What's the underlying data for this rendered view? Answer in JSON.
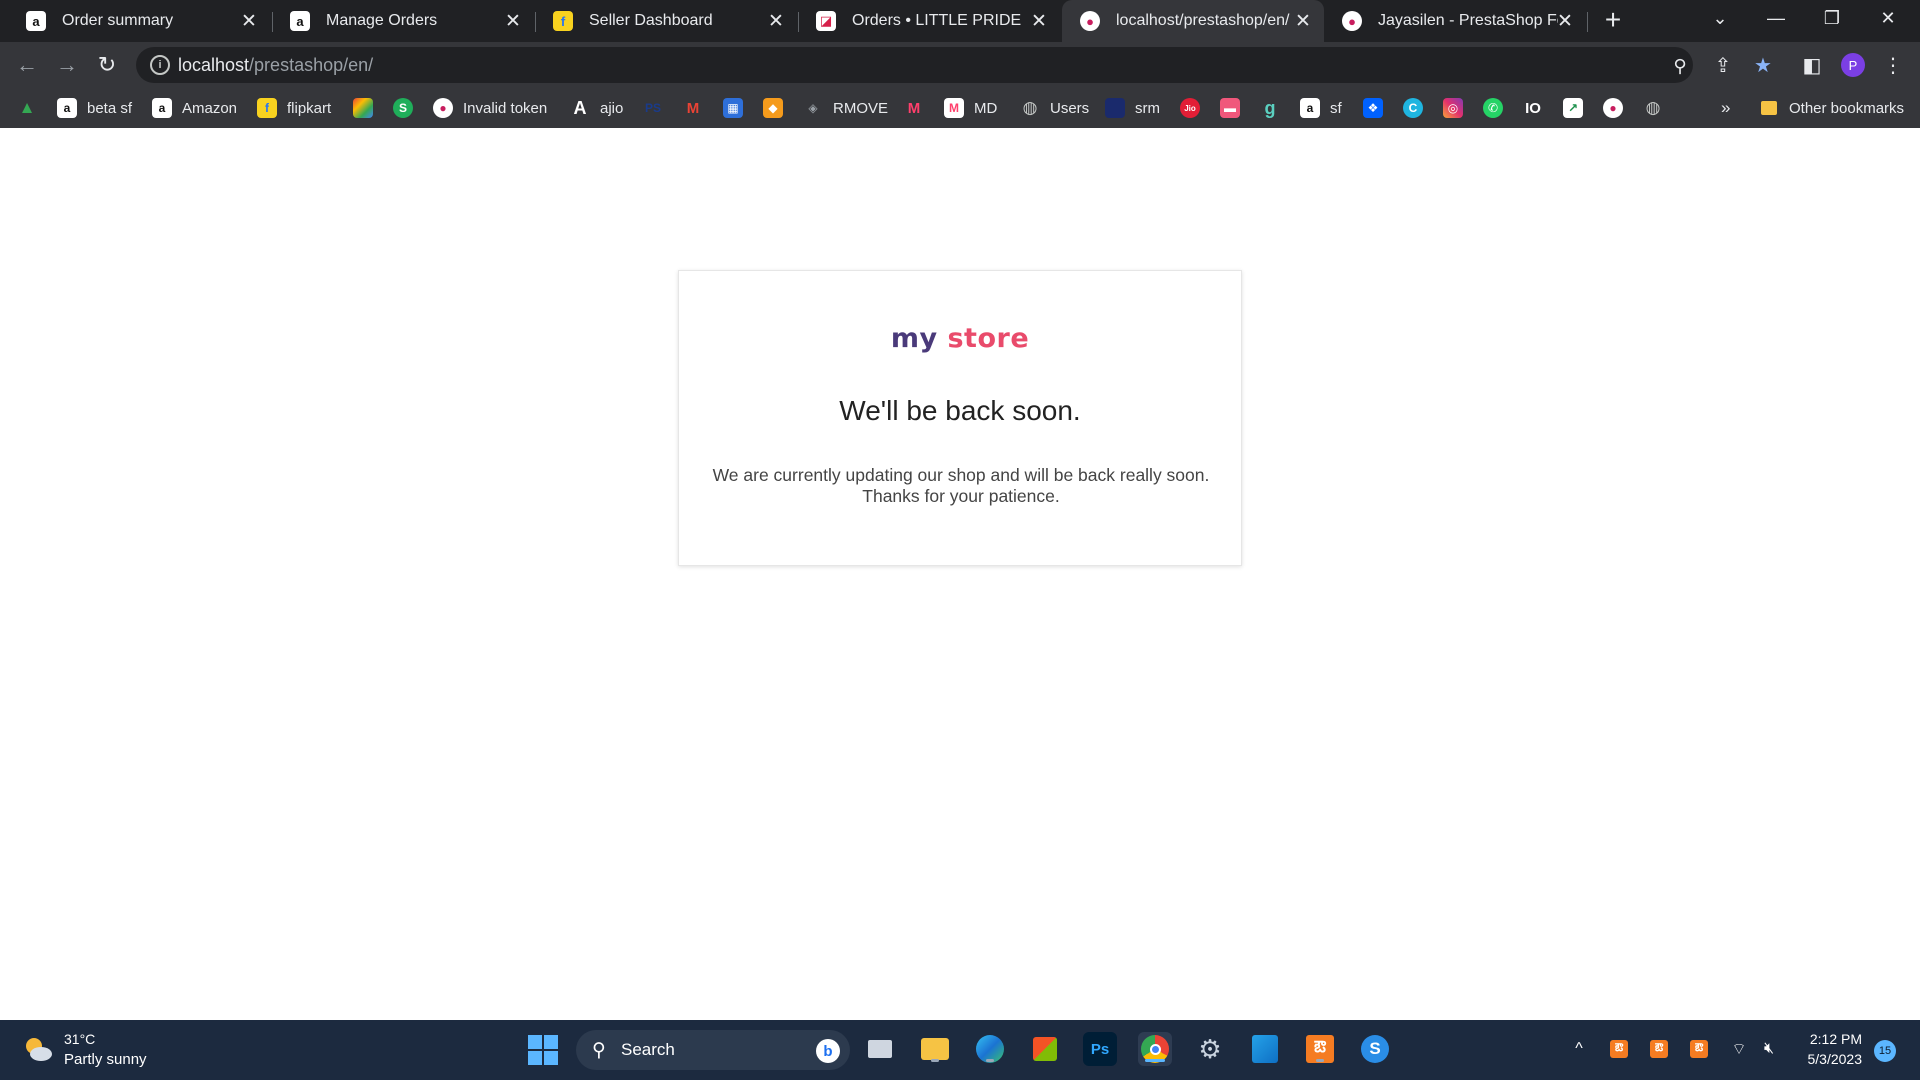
{
  "browser": {
    "tabs": [
      {
        "title": "Order summary",
        "icon": "amazon-icon",
        "active": false
      },
      {
        "title": "Manage Orders",
        "icon": "amazon-icon",
        "active": false
      },
      {
        "title": "Seller Dashboard",
        "icon": "flipkart-icon",
        "active": false
      },
      {
        "title": "Orders • LITTLE PRIDE",
        "icon": "orders-icon",
        "active": false
      },
      {
        "title": "localhost/prestashop/en/",
        "icon": "prestashop-icon",
        "active": true
      },
      {
        "title": "Jayasilen - PrestaShop Foru",
        "icon": "prestashop-icon",
        "active": false
      }
    ],
    "address": {
      "host": "localhost",
      "path": "/prestashop/en/"
    },
    "profile_initial": "P",
    "bookmarks": [
      {
        "label": "",
        "icon": "drive-icon"
      },
      {
        "label": "beta sf",
        "icon": "amazon-icon"
      },
      {
        "label": "Amazon",
        "icon": "amazon-icon"
      },
      {
        "label": "flipkart",
        "icon": "flipkart-icon"
      },
      {
        "label": "",
        "icon": "apps-grid-icon"
      },
      {
        "label": "",
        "icon": "s-icon"
      },
      {
        "label": "Invalid token",
        "icon": "prestashop-icon"
      },
      {
        "label": "ajio",
        "icon": "ajio-icon"
      },
      {
        "label": "",
        "icon": "ps-icon"
      },
      {
        "label": "",
        "icon": "gmail-icon"
      },
      {
        "label": "",
        "icon": "qr-icon"
      },
      {
        "label": "",
        "icon": "ticket-icon"
      },
      {
        "label": "RMOVE",
        "icon": "layers-icon"
      },
      {
        "label": "",
        "icon": "myntra-icon"
      },
      {
        "label": "MD",
        "icon": "myntra-icon"
      },
      {
        "label": "Users",
        "icon": "globe-icon"
      },
      {
        "label": "srm",
        "icon": "srm-icon"
      },
      {
        "label": "",
        "icon": "jio-icon"
      },
      {
        "label": "",
        "icon": "card-icon"
      },
      {
        "label": "",
        "icon": "g-icon"
      },
      {
        "label": "sf",
        "icon": "amazon-icon"
      },
      {
        "label": "",
        "icon": "dropbox-icon"
      },
      {
        "label": "",
        "icon": "canva-icon"
      },
      {
        "label": "",
        "icon": "instagram-icon"
      },
      {
        "label": "",
        "icon": "whatsapp-icon"
      },
      {
        "label": "",
        "icon": "io-icon"
      },
      {
        "label": "",
        "icon": "chart-icon"
      },
      {
        "label": "",
        "icon": "prestashop-icon"
      },
      {
        "label": "",
        "icon": "globe-icon"
      }
    ],
    "bookmarks_overflow": "»",
    "other_bookmarks": "Other bookmarks"
  },
  "page": {
    "logo_part1": "my",
    "logo_part2": "store",
    "headline": "We'll be back soon.",
    "message_line1": "We are currently updating our shop and will be back really soon.",
    "message_line2": "Thanks for your patience."
  },
  "taskbar": {
    "weather_temp": "31°C",
    "weather_desc": "Partly sunny",
    "search_label": "Search",
    "time": "2:12 PM",
    "date": "5/3/2023",
    "notifications": "15"
  }
}
